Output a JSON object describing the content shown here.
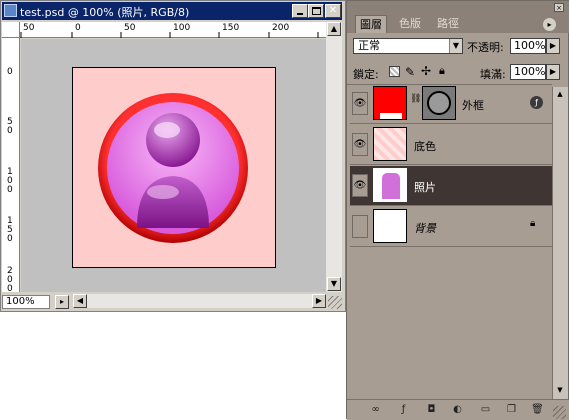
{
  "document": {
    "title": "test.psd @ 100% (照片, RGB/8)",
    "ruler_top": [
      "50",
      "0",
      "50",
      "100",
      "150",
      "200"
    ],
    "ruler_left": [
      "0",
      "5\n0",
      "1\n0\n0",
      "1\n5\n0",
      "2\n0\n0"
    ],
    "zoom": "100%",
    "image": {
      "background_color": "#ffcccc",
      "ring_color": "#e00000",
      "circle_color": "#e580e8",
      "figure_color": "#9a1da3"
    }
  },
  "panel": {
    "tabs": [
      "圖層",
      "色版",
      "路徑"
    ],
    "mode": "正常",
    "opacity_label": "不透明:",
    "opacity": "100%",
    "lock_label": "鎖定:",
    "fill_label": "填滿:",
    "fill": "100%",
    "layers": [
      {
        "name": "外框",
        "visible": true,
        "selected": false,
        "thumb_color": "#ff0000",
        "has_mask": true,
        "has_fx": true
      },
      {
        "name": "底色",
        "visible": true,
        "selected": false,
        "thumb_color": "#ffcccc",
        "has_mask": false,
        "has_fx": false
      },
      {
        "name": "照片",
        "visible": true,
        "selected": true,
        "thumb_color": "#d070d8",
        "has_mask": false,
        "has_fx": false
      },
      {
        "name": "背景",
        "visible": false,
        "selected": false,
        "thumb_color": "#ffffff",
        "has_mask": false,
        "has_fx": false,
        "locked": true
      }
    ],
    "footer_icons": [
      "link-icon",
      "fx-icon",
      "mask-icon",
      "adjustment-icon",
      "folder-icon",
      "new-layer-icon",
      "trash-icon"
    ]
  }
}
